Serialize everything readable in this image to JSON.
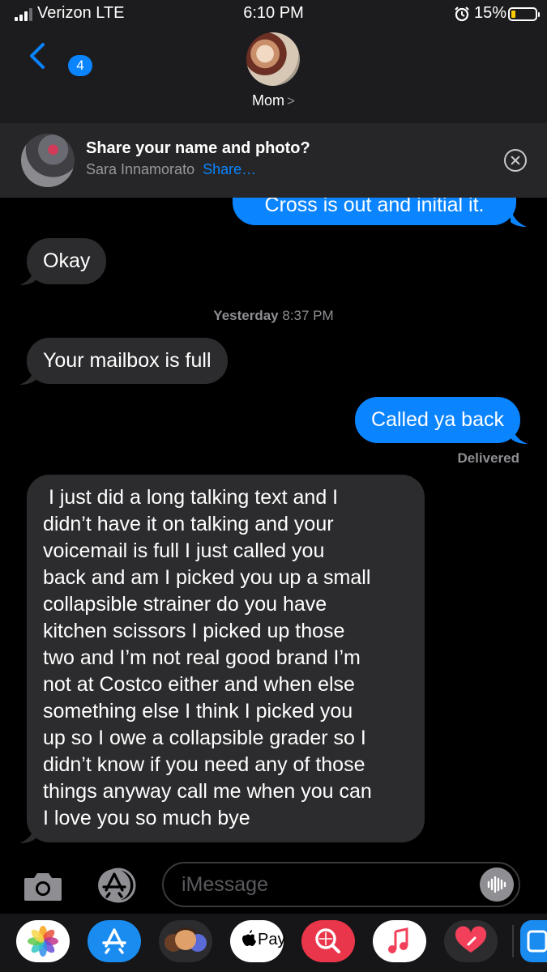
{
  "status_bar": {
    "carrier": "Verizon LTE",
    "time": "6:10 PM",
    "battery_percent": "15%",
    "battery_level": 0.15,
    "icons": [
      "signal-icon",
      "alarm-icon",
      "battery-icon"
    ]
  },
  "header": {
    "back_badge": "4",
    "contact_name": "Mom",
    "contact_chevron": ">",
    "icons": [
      "back-chevron-icon",
      "contact-avatar"
    ]
  },
  "share_banner": {
    "title": "Share your name and photo?",
    "name": "Sara Innamorato",
    "action": "Share…",
    "icons": [
      "close-icon"
    ]
  },
  "messages": [
    {
      "direction": "outgoing",
      "text": "Cross is out and initial it."
    },
    {
      "direction": "incoming",
      "text": "Okay"
    },
    {
      "timestamp_day": "Yesterday",
      "timestamp_time": "8:37 PM"
    },
    {
      "direction": "incoming",
      "text": "Your mailbox is full"
    },
    {
      "direction": "outgoing",
      "text": "Called ya back",
      "status": "Delivered"
    },
    {
      "direction": "incoming",
      "lines": [
        " I just did a long talking text and I",
        "didn’t have it on talking and your",
        "voicemail is full I just called you",
        "back and am I picked you up a small",
        "collapsible strainer do you have",
        "kitchen scissors I picked up those",
        "two and I’m not real good brand I’m",
        "not at Costco either and when else",
        "something else I think I picked you",
        "up so I owe a collapsible grader so I",
        "didn’t know if you need any of those",
        "things anyway call me when you can",
        "I love you so much bye"
      ]
    }
  ],
  "compose": {
    "placeholder": "iMessage",
    "icons": [
      "camera-icon",
      "app-store-icon",
      "audio-message-icon"
    ]
  },
  "app_drawer": {
    "apple_pay_label": "Pay",
    "apps": [
      "photos-app-icon",
      "app-store-app-icon",
      "memoji-app-icon",
      "apple-pay-app-icon",
      "search-images-app-icon",
      "music-app-icon",
      "digital-touch-app-icon",
      "more-app-icon"
    ]
  },
  "colors": {
    "incoming_bubble": "#2c2c2e",
    "outgoing_bubble": "#0a84ff",
    "background": "#000000",
    "link": "#0a84ff"
  }
}
